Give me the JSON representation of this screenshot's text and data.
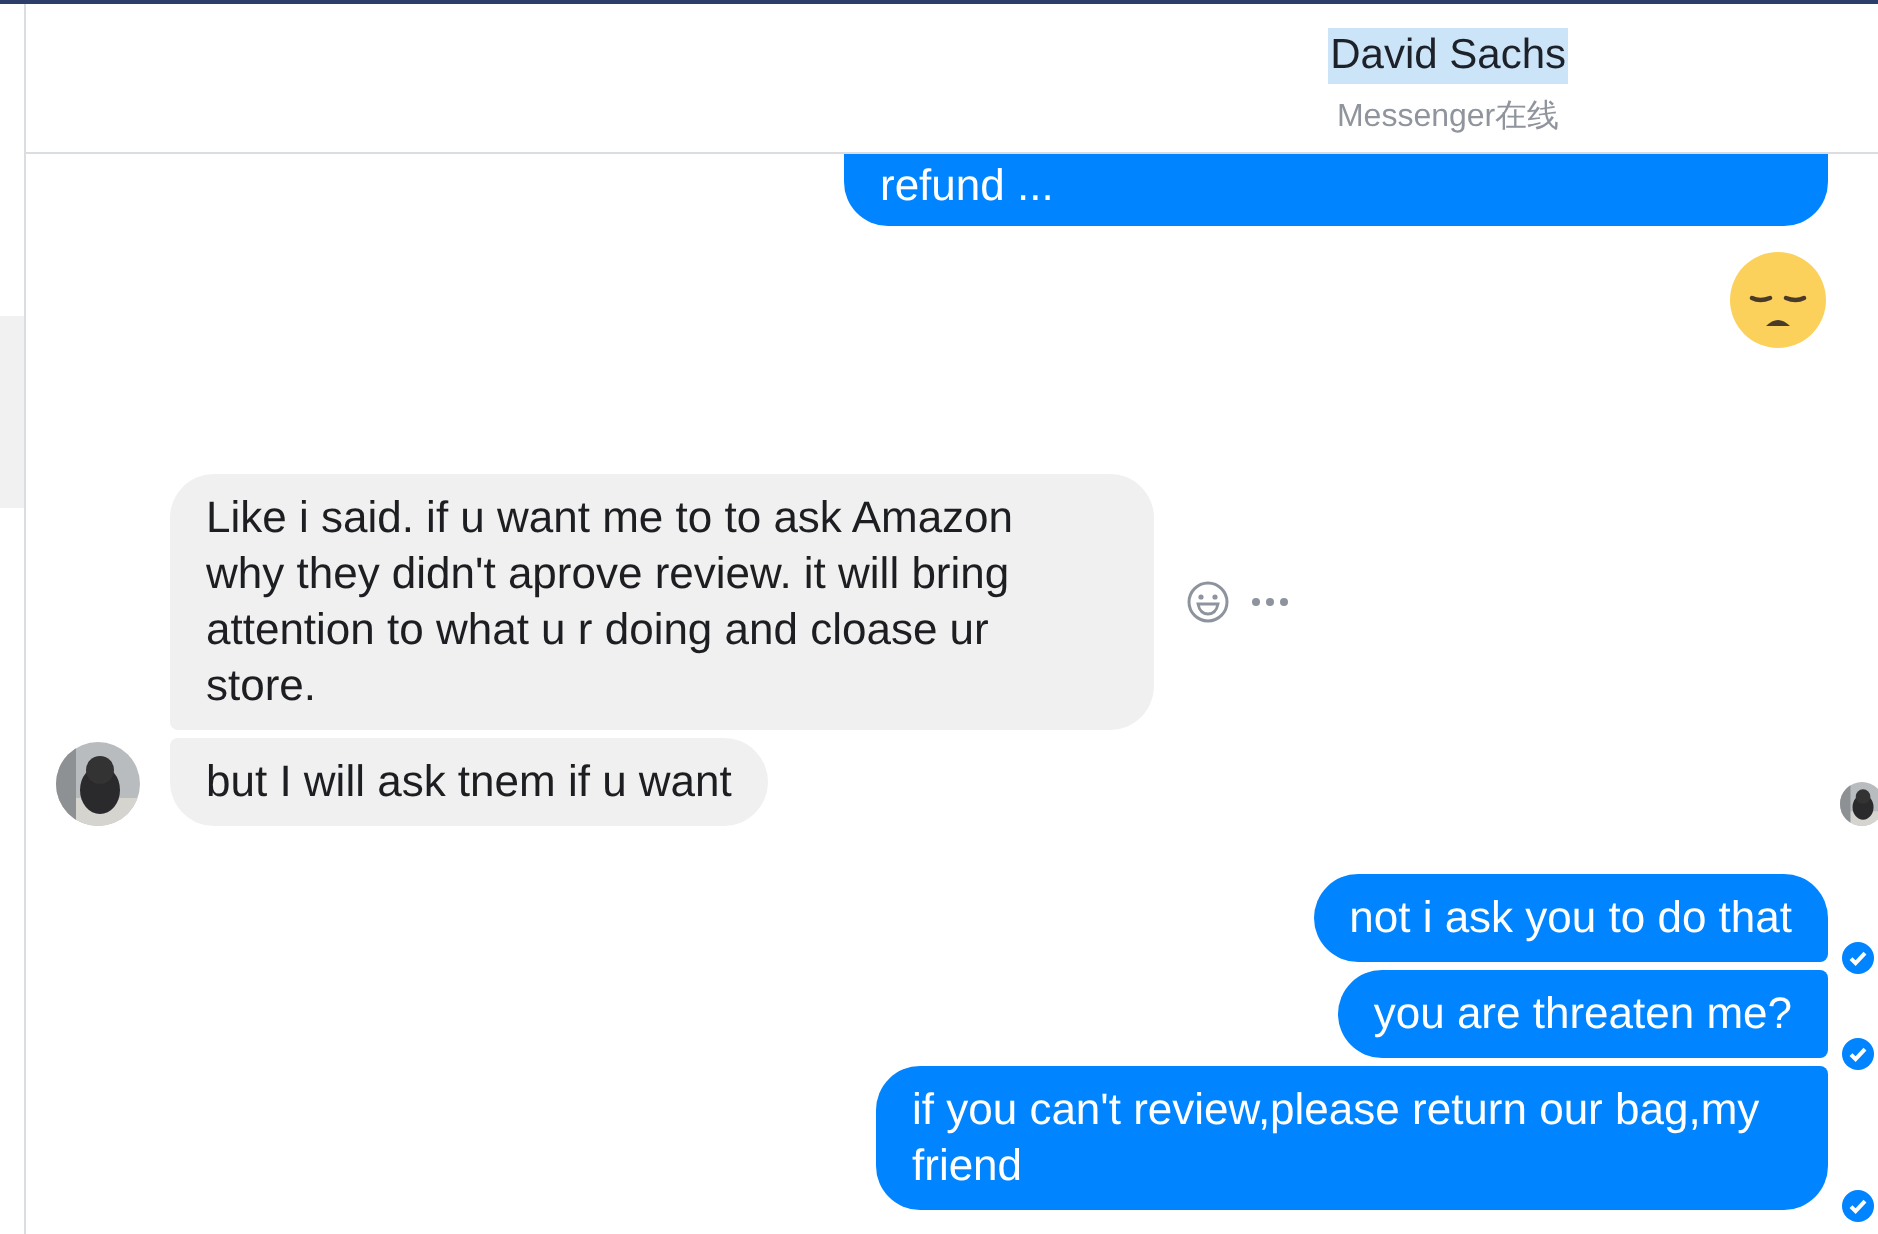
{
  "header": {
    "title": "David Sachs",
    "title_selected": true,
    "subtitle": "Messenger在线"
  },
  "groups": [
    {
      "kind": "outgoing",
      "messages": [
        {
          "kind": "text",
          "text": "refund ...",
          "cut_top": true
        },
        {
          "kind": "emoji"
        }
      ]
    },
    {
      "kind": "incoming",
      "avatar": true,
      "actions": true,
      "messages": [
        {
          "kind": "text",
          "text": "Like i said. if u want me to to ask Amazon why they didn't aprove review. it will bring attention to what u r doing and cloase ur store."
        },
        {
          "kind": "text",
          "text": "but I will ask tnem if u want"
        }
      ],
      "seen": true
    },
    {
      "kind": "outgoing",
      "messages": [
        {
          "kind": "text",
          "text": "not i ask you to do that",
          "delivered": true
        },
        {
          "kind": "text",
          "text": "you are threaten me?",
          "delivered": true
        },
        {
          "kind": "text",
          "text": "if you can't review,please return our bag,my friend",
          "delivered": true
        }
      ]
    }
  ]
}
